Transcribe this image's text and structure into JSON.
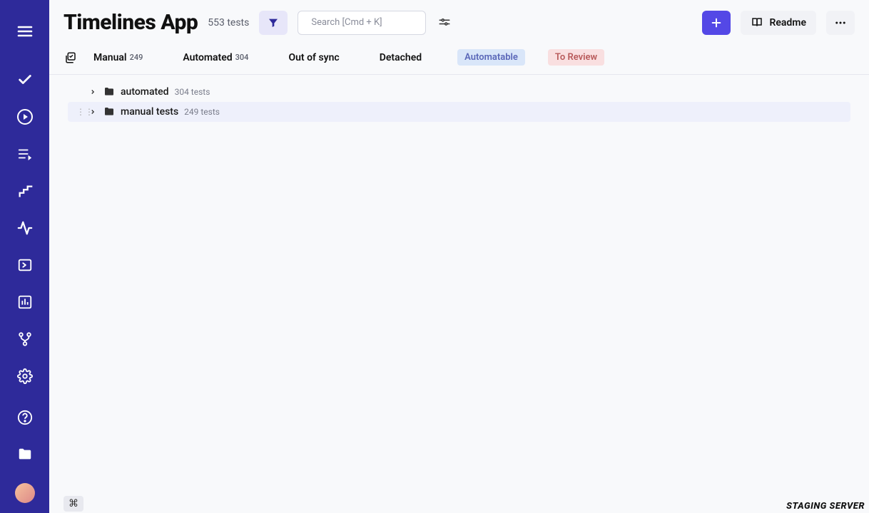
{
  "header": {
    "title": "Timelines App",
    "tests_count": "553 tests",
    "search_placeholder": "Search [Cmd + K]",
    "readme_label": "Readme"
  },
  "tabs": {
    "manual": {
      "label": "Manual",
      "count": "249"
    },
    "automated": {
      "label": "Automated",
      "count": "304"
    },
    "out_of_sync": {
      "label": "Out of sync"
    },
    "detached": {
      "label": "Detached"
    },
    "automatable": {
      "label": "Automatable"
    },
    "to_review": {
      "label": "To Review"
    }
  },
  "tree": {
    "automated": {
      "label": "automated",
      "count": "304 tests"
    },
    "manual": {
      "label": "manual tests",
      "count": "249 tests"
    }
  },
  "footer": {
    "env": "STAGING SERVER"
  }
}
